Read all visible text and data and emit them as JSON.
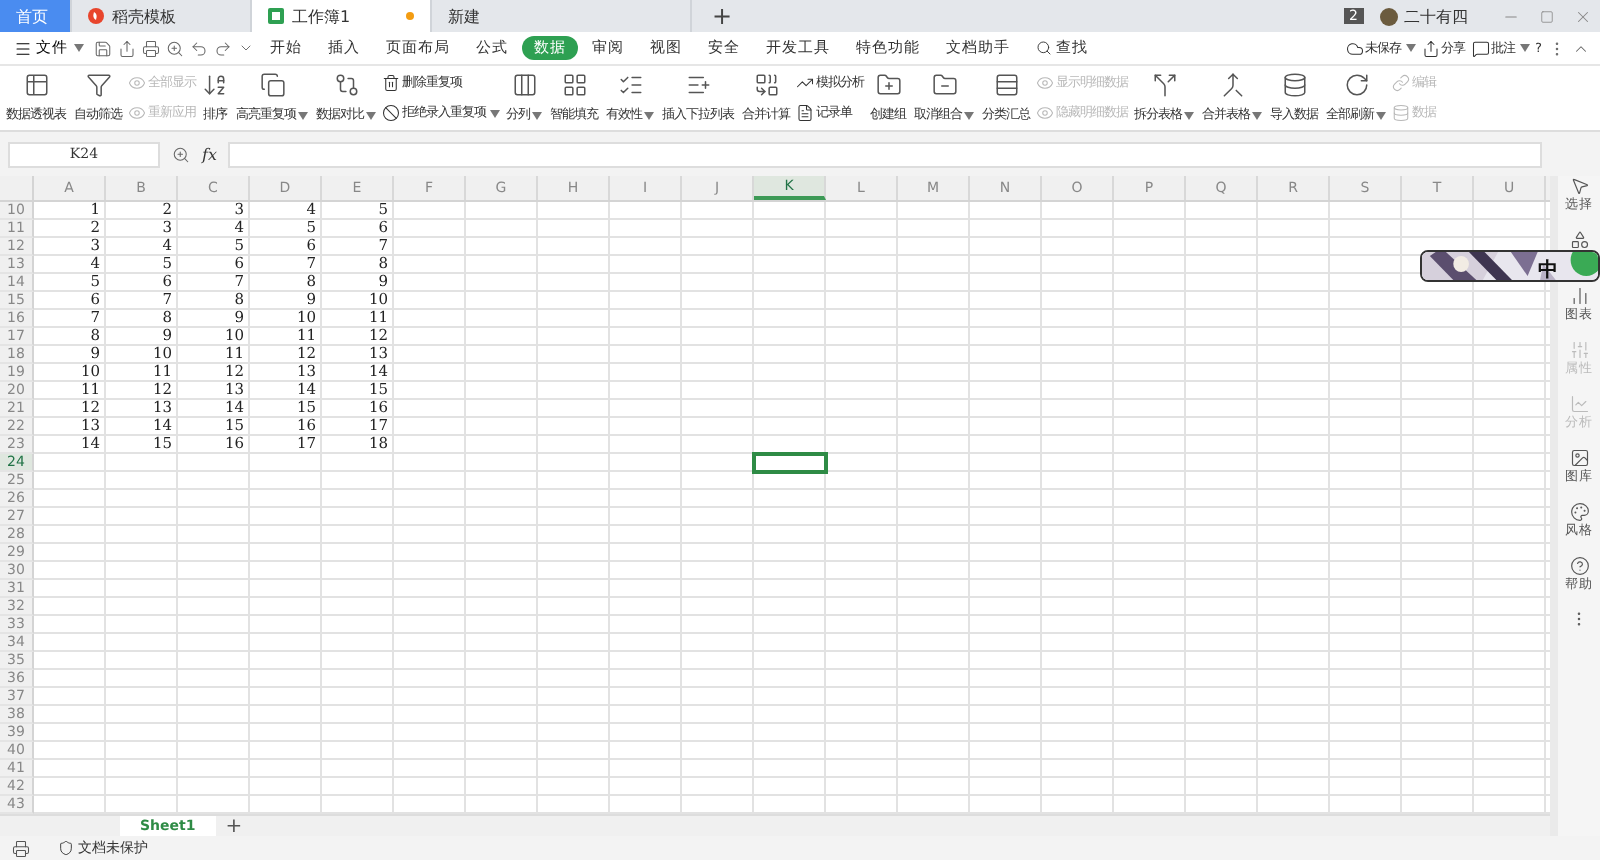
{
  "tabs": [
    {
      "label": "首页",
      "kind": "home",
      "selected": false,
      "unsaved": false
    },
    {
      "label": "稻壳模板",
      "kind": "docer",
      "selected": false,
      "unsaved": false
    },
    {
      "label": "工作簿1",
      "kind": "sheet",
      "selected": true,
      "unsaved": true
    },
    {
      "label": "新建",
      "kind": "plain",
      "selected": false,
      "unsaved": false
    }
  ],
  "new_tab_button": "+",
  "account": {
    "badge": "2",
    "name": "二十有四"
  },
  "menu": {
    "file": "文件",
    "items": [
      {
        "label": "开始",
        "selected": false
      },
      {
        "label": "插入",
        "selected": false
      },
      {
        "label": "页面布局",
        "selected": false
      },
      {
        "label": "公式",
        "selected": false
      },
      {
        "label": "数据",
        "selected": true
      },
      {
        "label": "审阅",
        "selected": false
      },
      {
        "label": "视图",
        "selected": false
      },
      {
        "label": "安全",
        "selected": false
      },
      {
        "label": "开发工具",
        "selected": false
      },
      {
        "label": "特色功能",
        "selected": false
      },
      {
        "label": "文档助手",
        "selected": false
      }
    ],
    "search": "查找",
    "right": [
      {
        "label": "未保存",
        "dropdown": true
      },
      {
        "label": "分享",
        "dropdown": false
      },
      {
        "label": "批注",
        "dropdown": true
      }
    ],
    "help": "?"
  },
  "ribbon": [
    {
      "kind": "big",
      "label": "数据透视表",
      "dropdown": false
    },
    {
      "kind": "big",
      "label": "自动筛选",
      "dropdown": false
    },
    {
      "kind": "stack",
      "items": [
        {
          "label": "全部显示",
          "disabled": true,
          "dropdown": false
        },
        {
          "label": "重新应用",
          "disabled": true,
          "dropdown": false
        }
      ]
    },
    {
      "kind": "big",
      "label": "排序",
      "dropdown": false
    },
    {
      "kind": "big",
      "label": "高亮重复项",
      "dropdown": true
    },
    {
      "kind": "big",
      "label": "数据对比",
      "dropdown": true
    },
    {
      "kind": "stack",
      "items": [
        {
          "label": "删除重复项",
          "disabled": false,
          "dropdown": false
        },
        {
          "label": "拒绝录入重复项",
          "disabled": false,
          "dropdown": true
        }
      ]
    },
    {
      "kind": "big",
      "label": "分列",
      "dropdown": true
    },
    {
      "kind": "big",
      "label": "智能填充",
      "dropdown": false
    },
    {
      "kind": "big",
      "label": "有效性",
      "dropdown": true
    },
    {
      "kind": "big",
      "label": "插入下拉列表",
      "dropdown": false
    },
    {
      "kind": "big",
      "label": "合并计算",
      "dropdown": false
    },
    {
      "kind": "stack",
      "items": [
        {
          "label": "模拟分析",
          "disabled": false,
          "dropdown": false
        },
        {
          "label": "记录单",
          "disabled": false,
          "dropdown": false
        }
      ]
    },
    {
      "kind": "big",
      "label": "创建组",
      "dropdown": false
    },
    {
      "kind": "big",
      "label": "取消组合",
      "dropdown": true
    },
    {
      "kind": "big",
      "label": "分类汇总",
      "dropdown": false
    },
    {
      "kind": "stack",
      "items": [
        {
          "label": "显示明细数据",
          "disabled": true,
          "dropdown": false
        },
        {
          "label": "隐藏明细数据",
          "disabled": true,
          "dropdown": false
        }
      ]
    },
    {
      "kind": "big",
      "label": "拆分表格",
      "dropdown": true
    },
    {
      "kind": "big",
      "label": "合并表格",
      "dropdown": true
    },
    {
      "kind": "big",
      "label": "导入数据",
      "dropdown": false
    },
    {
      "kind": "big",
      "label": "全部刷新",
      "dropdown": true
    },
    {
      "kind": "stack",
      "items": [
        {
          "label": "编辑",
          "disabled": true,
          "dropdown": false
        },
        {
          "label": "数据",
          "disabled": true,
          "dropdown": false
        }
      ]
    }
  ],
  "formula_bar": {
    "name_box": "K24",
    "fx": "fx"
  },
  "sheet": {
    "columns": [
      {
        "label": "A",
        "selected": false
      },
      {
        "label": "B",
        "selected": false
      },
      {
        "label": "C",
        "selected": false
      },
      {
        "label": "D",
        "selected": false
      },
      {
        "label": "E",
        "selected": false
      },
      {
        "label": "F",
        "selected": false
      },
      {
        "label": "G",
        "selected": false
      },
      {
        "label": "H",
        "selected": false
      },
      {
        "label": "I",
        "selected": false
      },
      {
        "label": "J",
        "selected": false
      },
      {
        "label": "K",
        "selected": true
      },
      {
        "label": "L",
        "selected": false
      },
      {
        "label": "M",
        "selected": false
      },
      {
        "label": "N",
        "selected": false
      },
      {
        "label": "O",
        "selected": false
      },
      {
        "label": "P",
        "selected": false
      },
      {
        "label": "Q",
        "selected": false
      },
      {
        "label": "R",
        "selected": false
      },
      {
        "label": "S",
        "selected": false
      },
      {
        "label": "T",
        "selected": false
      },
      {
        "label": "U",
        "selected": false
      }
    ],
    "rows": [
      {
        "number": "10",
        "selected": false,
        "cells": [
          "1",
          "2",
          "3",
          "4",
          "5"
        ]
      },
      {
        "number": "11",
        "selected": false,
        "cells": [
          "2",
          "3",
          "4",
          "5",
          "6"
        ]
      },
      {
        "number": "12",
        "selected": false,
        "cells": [
          "3",
          "4",
          "5",
          "6",
          "7"
        ]
      },
      {
        "number": "13",
        "selected": false,
        "cells": [
          "4",
          "5",
          "6",
          "7",
          "8"
        ]
      },
      {
        "number": "14",
        "selected": false,
        "cells": [
          "5",
          "6",
          "7",
          "8",
          "9"
        ]
      },
      {
        "number": "15",
        "selected": false,
        "cells": [
          "6",
          "7",
          "8",
          "9",
          "10"
        ]
      },
      {
        "number": "16",
        "selected": false,
        "cells": [
          "7",
          "8",
          "9",
          "10",
          "11"
        ]
      },
      {
        "number": "17",
        "selected": false,
        "cells": [
          "8",
          "9",
          "10",
          "11",
          "12"
        ]
      },
      {
        "number": "18",
        "selected": false,
        "cells": [
          "9",
          "10",
          "11",
          "12",
          "13"
        ]
      },
      {
        "number": "19",
        "selected": false,
        "cells": [
          "10",
          "11",
          "12",
          "13",
          "14"
        ]
      },
      {
        "number": "20",
        "selected": false,
        "cells": [
          "11",
          "12",
          "13",
          "14",
          "15"
        ]
      },
      {
        "number": "21",
        "selected": false,
        "cells": [
          "12",
          "13",
          "14",
          "15",
          "16"
        ]
      },
      {
        "number": "22",
        "selected": false,
        "cells": [
          "13",
          "14",
          "15",
          "16",
          "17"
        ]
      },
      {
        "number": "23",
        "selected": false,
        "cells": [
          "14",
          "15",
          "16",
          "17",
          "18"
        ]
      },
      {
        "number": "24",
        "selected": true
      },
      {
        "number": "25",
        "selected": false
      },
      {
        "number": "26",
        "selected": false
      },
      {
        "number": "27",
        "selected": false
      },
      {
        "number": "28",
        "selected": false
      },
      {
        "number": "29",
        "selected": false
      },
      {
        "number": "30",
        "selected": false
      },
      {
        "number": "31",
        "selected": false
      },
      {
        "number": "32",
        "selected": false
      },
      {
        "number": "33",
        "selected": false
      },
      {
        "number": "34",
        "selected": false
      },
      {
        "number": "35",
        "selected": false
      },
      {
        "number": "36",
        "selected": false
      },
      {
        "number": "37",
        "selected": false
      },
      {
        "number": "38",
        "selected": false
      },
      {
        "number": "39",
        "selected": false
      },
      {
        "number": "40",
        "selected": false
      },
      {
        "number": "41",
        "selected": false
      },
      {
        "number": "42",
        "selected": false
      },
      {
        "number": "43",
        "selected": false
      }
    ]
  },
  "side_panel": [
    {
      "label": "选择",
      "disabled": false
    },
    {
      "label": "图表",
      "disabled": false
    },
    {
      "label": "属性",
      "disabled": true
    },
    {
      "label": "分析",
      "disabled": true
    },
    {
      "label": "图库",
      "disabled": false
    },
    {
      "label": "风格",
      "disabled": false
    },
    {
      "label": "帮助",
      "disabled": false
    }
  ],
  "ime": {
    "label": "中"
  },
  "sheet_tabs": [
    {
      "label": "Sheet1",
      "selected": true
    }
  ],
  "add_sheet": "+",
  "status": "文档未保护"
}
